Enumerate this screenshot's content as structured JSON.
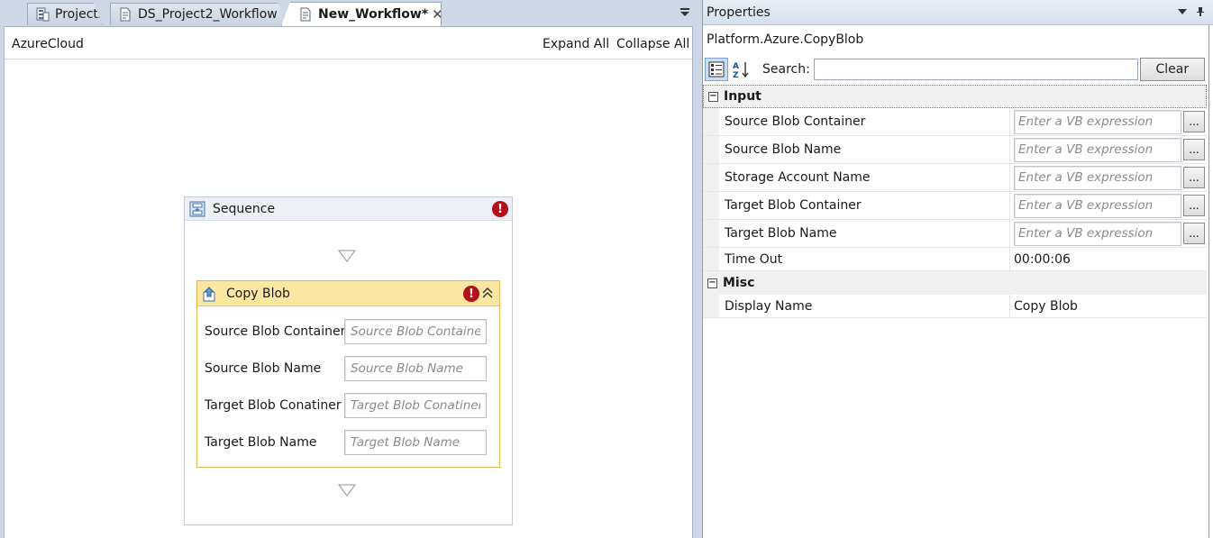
{
  "tabs": [
    {
      "label": "Projects",
      "active": false
    },
    {
      "label": "DS_Project2_Workflow",
      "active": false
    },
    {
      "label": "New_Workflow*",
      "active": true
    }
  ],
  "designer": {
    "breadcrumb": "AzureCloud",
    "expand_all": "Expand All",
    "collapse_all": "Collapse All",
    "sequence": {
      "title": "Sequence",
      "error_glyph": "!"
    },
    "activity": {
      "title": "Copy Blob",
      "error_glyph": "!",
      "arguments": [
        {
          "label": "Source Blob Container",
          "placeholder": "Source Blob Container"
        },
        {
          "label": "Source Blob Name",
          "placeholder": "Source Blob Name"
        },
        {
          "label": "Target Blob Conatiner",
          "placeholder": "Target Blob Conatiner"
        },
        {
          "label": "Target Blob Name",
          "placeholder": "Target Blob Name"
        }
      ]
    }
  },
  "properties": {
    "title": "Properties",
    "type_name": "Platform.Azure.CopyBlob",
    "search_label": "Search:",
    "search_value": "",
    "clear_label": "Clear",
    "categories": [
      {
        "name": "Input",
        "toggle": "−",
        "items": [
          {
            "name": "Source Blob Container",
            "placeholder": "Enter a VB expression",
            "button": "..."
          },
          {
            "name": "Source Blob Name",
            "placeholder": "Enter a VB expression",
            "button": "..."
          },
          {
            "name": "Storage Account Name",
            "placeholder": "Enter a VB expression",
            "button": "..."
          },
          {
            "name": "Target Blob Container",
            "placeholder": "Enter a VB expression",
            "button": "..."
          },
          {
            "name": "Target Blob Name",
            "placeholder": "Enter a VB expression",
            "button": "..."
          },
          {
            "name": "Time Out",
            "value": "00:00:06"
          }
        ]
      },
      {
        "name": "Misc",
        "toggle": "−",
        "items": [
          {
            "name": "Display Name",
            "value": "Copy Blob"
          }
        ]
      }
    ]
  },
  "colors": {
    "activity_header": "#fbe6a2",
    "activity_border": "#e3b954",
    "error_red": "#b3101a",
    "chrome_blue": "#cdd7e6"
  }
}
